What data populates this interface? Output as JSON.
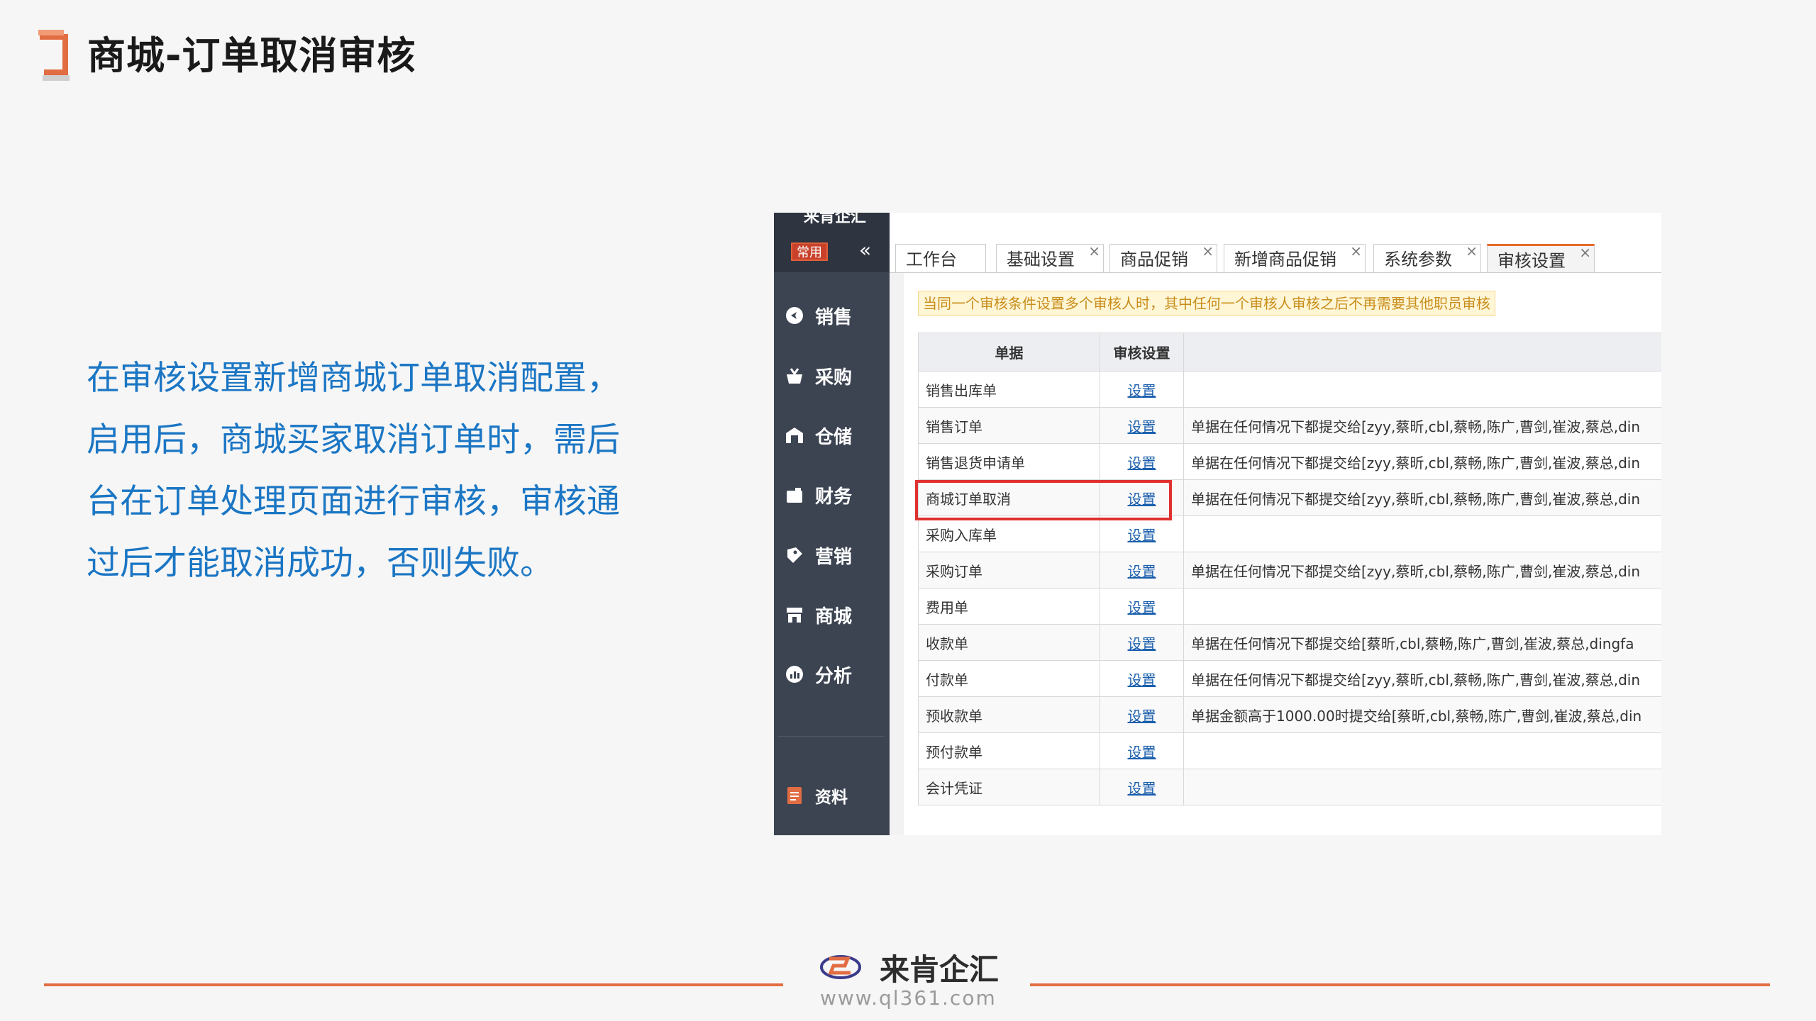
{
  "page": {
    "title": "商城-订单取消审核",
    "description_lines": [
      "在审核设置新增商城订单取消配置，",
      "启用后，商城买家取消订单时，需后",
      "台在订单处理页面进行审核，审核通",
      "过后才能取消成功，否则失败。"
    ]
  },
  "app": {
    "sidebar": {
      "common_label": "常用",
      "collapse_icon": "double-chevron-left-icon",
      "items": [
        {
          "label": "销售",
          "icon": "sales-icon"
        },
        {
          "label": "采购",
          "icon": "purchase-icon"
        },
        {
          "label": "仓储",
          "icon": "warehouse-icon"
        },
        {
          "label": "财务",
          "icon": "finance-icon"
        },
        {
          "label": "营销",
          "icon": "marketing-icon"
        },
        {
          "label": "商城",
          "icon": "mall-icon"
        },
        {
          "label": "分析",
          "icon": "analysis-icon"
        },
        {
          "label": "资料",
          "icon": "document-icon"
        }
      ]
    },
    "tabs": [
      {
        "label": "工作台",
        "closable": false,
        "active": false
      },
      {
        "label": "基础设置",
        "closable": true,
        "active": false
      },
      {
        "label": "商品促销",
        "closable": true,
        "active": false
      },
      {
        "label": "新增商品促销",
        "closable": true,
        "active": false
      },
      {
        "label": "系统参数",
        "closable": true,
        "active": false
      },
      {
        "label": "审核设置",
        "closable": true,
        "active": true
      }
    ],
    "notice": "当同一个审核条件设置多个审核人时，其中任何一个审核人审核之后不再需要其他职员审核",
    "table": {
      "headers": [
        "单据",
        "审核设置",
        ""
      ],
      "rows": [
        {
          "doc": "销售出库单",
          "action": "设置",
          "rule": ""
        },
        {
          "doc": "销售订单",
          "action": "设置",
          "rule": "单据在任何情况下都提交给[zyy,蔡昕,cbl,蔡畅,陈广,曹剑,崔波,蔡总,din"
        },
        {
          "doc": "销售退货申请单",
          "action": "设置",
          "rule": "单据在任何情况下都提交给[zyy,蔡昕,cbl,蔡畅,陈广,曹剑,崔波,蔡总,din"
        },
        {
          "doc": "商城订单取消",
          "action": "设置",
          "rule": "单据在任何情况下都提交给[zyy,蔡昕,cbl,蔡畅,陈广,曹剑,崔波,蔡总,din"
        },
        {
          "doc": "采购入库单",
          "action": "设置",
          "rule": ""
        },
        {
          "doc": "采购订单",
          "action": "设置",
          "rule": "单据在任何情况下都提交给[zyy,蔡昕,cbl,蔡畅,陈广,曹剑,崔波,蔡总,din"
        },
        {
          "doc": "费用单",
          "action": "设置",
          "rule": ""
        },
        {
          "doc": "收款单",
          "action": "设置",
          "rule": "单据在任何情况下都提交给[蔡昕,cbl,蔡畅,陈广,曹剑,崔波,蔡总,dingfa"
        },
        {
          "doc": "付款单",
          "action": "设置",
          "rule": "单据在任何情况下都提交给[zyy,蔡昕,cbl,蔡畅,陈广,曹剑,崔波,蔡总,din"
        },
        {
          "doc": "预收款单",
          "action": "设置",
          "rule": "单据金额高于1000.00时提交给[蔡昕,cbl,蔡畅,陈广,曹剑,崔波,蔡总,din"
        },
        {
          "doc": "预付款单",
          "action": "设置",
          "rule": ""
        },
        {
          "doc": "会计凭证",
          "action": "设置",
          "rule": ""
        }
      ]
    }
  },
  "footer": {
    "brand": "来肯企汇",
    "url": "www.ql361.com"
  },
  "colors": {
    "accent": "#e26d43",
    "text_blue": "#1b76c4",
    "sidebar_bg": "#3c4452",
    "highlight_red": "#e03030"
  }
}
